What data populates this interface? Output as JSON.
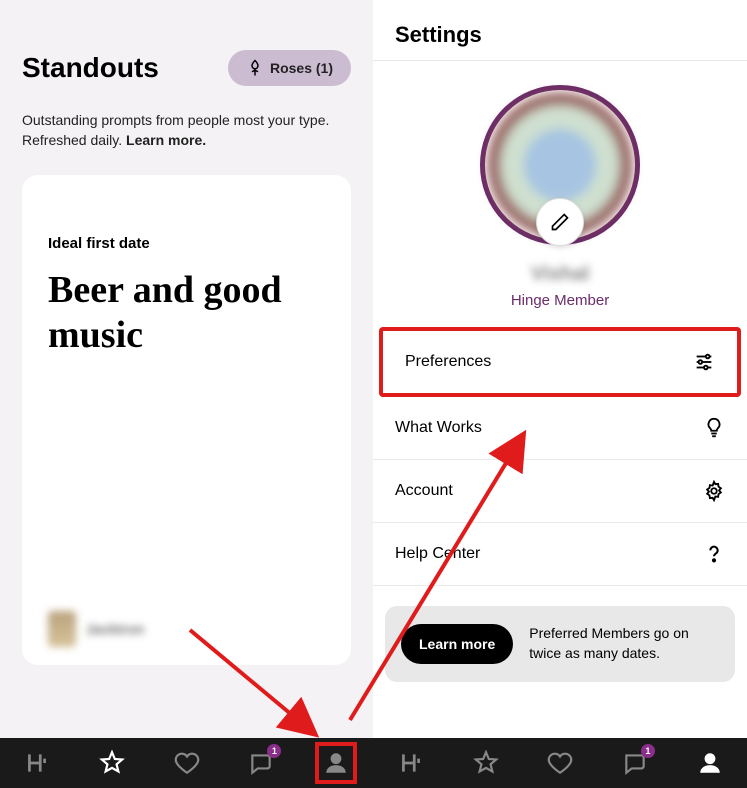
{
  "left": {
    "title": "Standouts",
    "roses_label": "Roses (1)",
    "subtitle": "Outstanding prompts from people most your type. Refreshed daily. ",
    "learn_more": "Learn more.",
    "card": {
      "prompt": "Ideal first date",
      "answer": "Beer and good music",
      "author": "Jacktron"
    }
  },
  "right": {
    "title": "Settings",
    "profile_name": "Vishal",
    "member_label": "Hinge Member",
    "menu": [
      {
        "label": "Preferences"
      },
      {
        "label": "What Works"
      },
      {
        "label": "Account"
      },
      {
        "label": "Help Center"
      }
    ],
    "promo_button": "Learn more",
    "promo_text": "Preferred Members go on twice as many dates."
  },
  "nav": {
    "badge_count": "1"
  }
}
